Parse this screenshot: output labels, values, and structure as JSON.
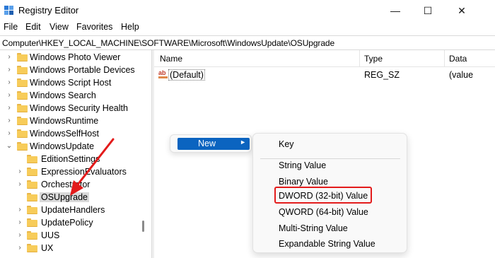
{
  "window": {
    "title": "Registry Editor",
    "minimize_glyph": "—",
    "maximize_glyph": "☐",
    "close_glyph": "✕"
  },
  "menu": {
    "items": [
      "File",
      "Edit",
      "View",
      "Favorites",
      "Help"
    ]
  },
  "address": {
    "path": "Computer\\HKEY_LOCAL_MACHINE\\SOFTWARE\\Microsoft\\WindowsUpdate\\OSUpgrade"
  },
  "tree": {
    "items": [
      {
        "label": "Windows Photo Viewer",
        "expander": "›"
      },
      {
        "label": "Windows Portable Devices",
        "expander": "›"
      },
      {
        "label": "Windows Script Host",
        "expander": "›"
      },
      {
        "label": "Windows Search",
        "expander": "›"
      },
      {
        "label": "Windows Security Health",
        "expander": "›"
      },
      {
        "label": "WindowsRuntime",
        "expander": "›"
      },
      {
        "label": "WindowsSelfHost",
        "expander": "›"
      },
      {
        "label": "WindowsUpdate",
        "expander": "⌄"
      },
      {
        "label": "EditionSettings",
        "expander": ""
      },
      {
        "label": "ExpressionEvaluators",
        "expander": "›"
      },
      {
        "label": "Orchestrator",
        "expander": "›"
      },
      {
        "label": "OSUpgrade",
        "expander": "",
        "selected": true
      },
      {
        "label": "UpdateHandlers",
        "expander": "›"
      },
      {
        "label": "UpdatePolicy",
        "expander": "›"
      },
      {
        "label": "UUS",
        "expander": "›"
      },
      {
        "label": "UX",
        "expander": "›"
      }
    ]
  },
  "list": {
    "columns": {
      "name": "Name",
      "type": "Type",
      "data": "Data"
    },
    "rows": [
      {
        "name": "(Default)",
        "type": "REG_SZ",
        "data": "(value"
      }
    ]
  },
  "context_menu": {
    "new_label": "New",
    "new_arrow": "►"
  },
  "submenu": {
    "items": [
      "Key",
      "String Value",
      "Binary Value",
      "DWORD (32-bit) Value",
      "QWORD (64-bit) Value",
      "Multi-String Value",
      "Expandable String Value"
    ],
    "highlighted": "DWORD (32-bit) Value"
  },
  "colors": {
    "accent": "#0b64c0",
    "annotation_red": "#e31b1b",
    "folder_yellow": "#f7cc5a"
  },
  "icons": {
    "app": "registry-editor-icon",
    "folder": "folder-icon",
    "string_value": "string-value-icon",
    "chevron": "chevron-icon"
  }
}
